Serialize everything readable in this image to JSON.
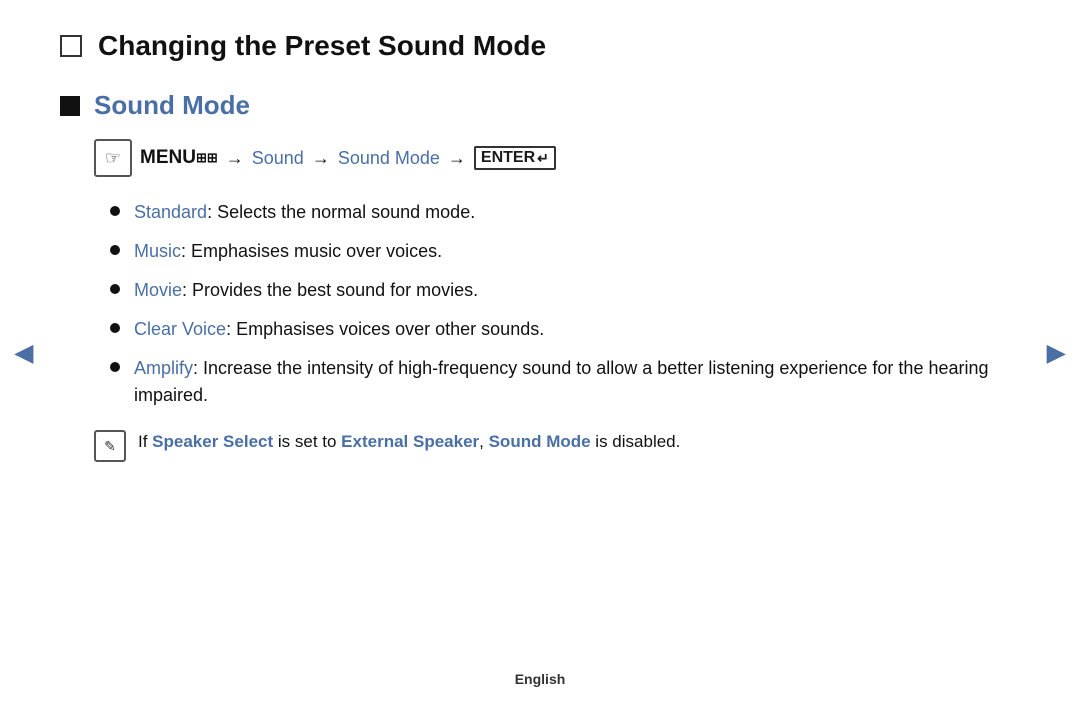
{
  "page": {
    "main_title": "Changing the Preset Sound Mode",
    "section": {
      "title": "Sound Mode",
      "menu_path": {
        "menu_label": "MENU",
        "arrow1": "→",
        "sound_label": "Sound",
        "arrow2": "→",
        "sound_mode_label": "Sound Mode",
        "arrow3": "→",
        "enter_label": "ENTER"
      },
      "items": [
        {
          "label": "Standard",
          "text": ": Selects the normal sound mode."
        },
        {
          "label": "Music",
          "text": ": Emphasises music over voices."
        },
        {
          "label": "Movie",
          "text": ": Provides the best sound for movies."
        },
        {
          "label": "Clear Voice",
          "text": ": Emphasises voices over other sounds."
        },
        {
          "label": "Amplify",
          "text": ": Increase the intensity of high-frequency sound to allow a better listening experience for the hearing impaired."
        }
      ],
      "note": {
        "prefix": " If ",
        "speaker_select": "Speaker Select",
        "middle": " is set to ",
        "external_speaker": "External Speaker",
        "comma": ", ",
        "sound_mode": "Sound Mode",
        "suffix": " is disabled."
      }
    },
    "footer": "English",
    "nav": {
      "left_arrow": "◄",
      "right_arrow": "►"
    }
  }
}
